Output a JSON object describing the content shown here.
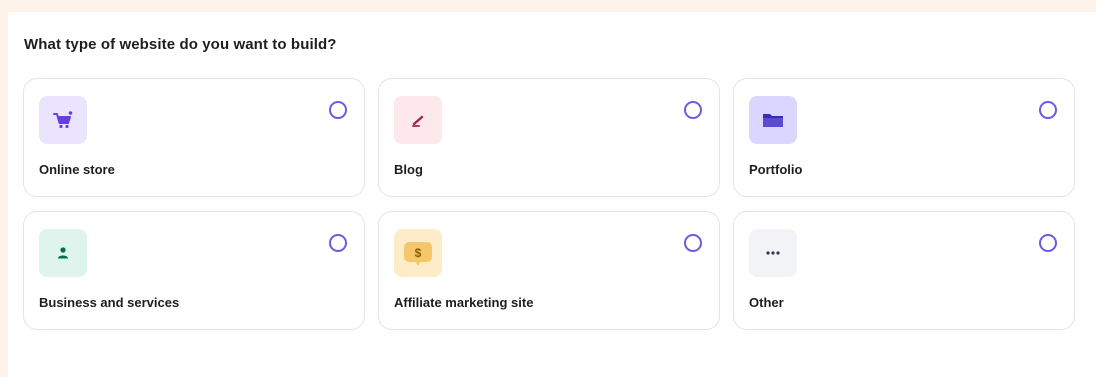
{
  "question": "What type of website do you want to build?",
  "options": [
    {
      "label": "Online store",
      "icon": "cart-icon",
      "icon_bg": "#ebe4ff",
      "icon_color": "#673de6",
      "selected": false
    },
    {
      "label": "Blog",
      "icon": "pencil-icon",
      "icon_bg": "#fde8ec",
      "icon_color": "#a3234a",
      "selected": false
    },
    {
      "label": "Portfolio",
      "icon": "folder-icon",
      "icon_bg": "#d9d6ff",
      "icon_color": "#5a4bd1",
      "selected": false
    },
    {
      "label": "Business and services",
      "icon": "person-icon",
      "icon_bg": "#def4ec",
      "icon_color": "#00704a",
      "selected": false
    },
    {
      "label": "Affiliate marketing site",
      "icon": "dollar-tag-icon",
      "icon_bg": "#fdecc8",
      "icon_color": "#8c5a00",
      "selected": false
    },
    {
      "label": "Other",
      "icon": "ellipsis-icon",
      "icon_bg": "#f2f3f6",
      "icon_color": "#36344d",
      "selected": false
    }
  ],
  "colors": {
    "radio_border": "#6c5be0",
    "page_background": "#fdf3ea",
    "card_border": "#e4e2ea"
  }
}
